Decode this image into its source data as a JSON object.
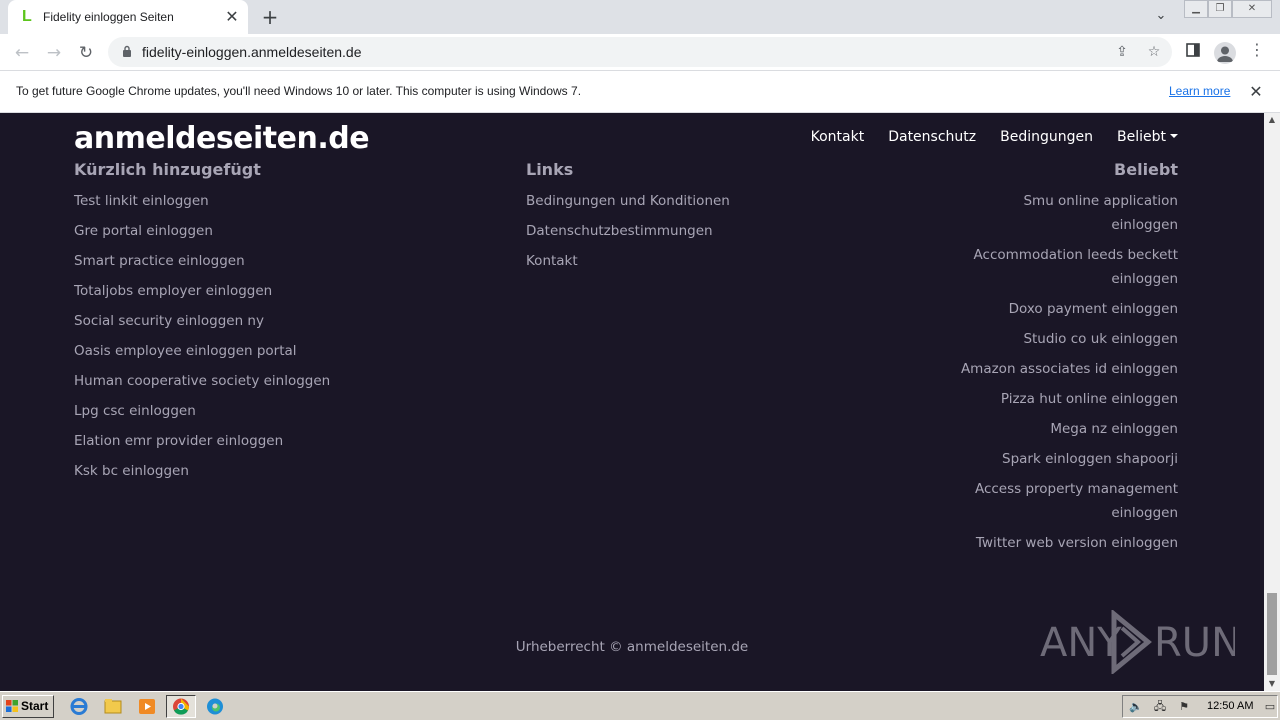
{
  "browser": {
    "tab_title": "Fidelity einloggen Seiten",
    "url": "fidelity-einloggen.anmeldeseiten.de",
    "new_tab_icon": "plus-icon",
    "close_tab_icon": "close-icon"
  },
  "infobar": {
    "message": "To get future Google Chrome updates, you'll need Windows 10 or later. This computer is using Windows 7.",
    "link": "Learn more"
  },
  "site": {
    "brand": "anmeldeseiten.de",
    "nav": [
      "Kontakt",
      "Datenschutz",
      "Bedingungen",
      "Beliebt"
    ],
    "recent": {
      "heading": "Kürzlich hinzugefügt",
      "items": [
        "Test linkit einloggen",
        "Gre portal einloggen",
        "Smart practice einloggen",
        "Totaljobs employer einloggen",
        "Social security einloggen ny",
        "Oasis employee einloggen portal",
        "Human cooperative society einloggen",
        "Lpg csc einloggen",
        "Elation emr provider einloggen",
        "Ksk bc einloggen"
      ]
    },
    "links": {
      "heading": "Links",
      "items": [
        "Bedingungen und Konditionen",
        "Datenschutzbestimmungen",
        "Kontakt"
      ]
    },
    "popular": {
      "heading": "Beliebt",
      "items": [
        "Smu online application",
        "einloggen",
        "Accommodation leeds beckett",
        "einloggen",
        "Doxo payment einloggen",
        "Studio co uk einloggen",
        "Amazon associates id einloggen",
        "Pizza hut online einloggen",
        "Mega nz einloggen",
        "Spark einloggen shapoorji",
        "Access property management",
        "einloggen",
        "Twitter web version einloggen"
      ]
    },
    "copyright": "Urheberrecht © anmeldeseiten.de",
    "watermark": "ANY RUN"
  },
  "taskbar": {
    "start": "Start",
    "clock": "12:50 AM"
  }
}
